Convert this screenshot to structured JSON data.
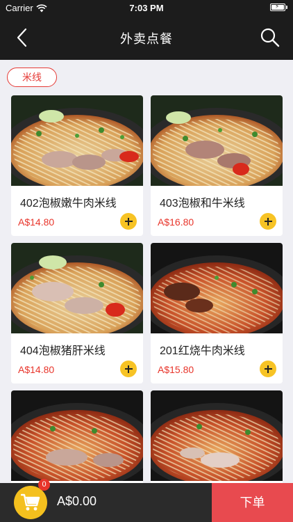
{
  "status_bar": {
    "carrier": "Carrier",
    "time": "7:03 PM"
  },
  "nav": {
    "title": "外卖点餐",
    "back_icon": "chevron-left-icon",
    "search_icon": "search-icon"
  },
  "category": {
    "label": "米线"
  },
  "products": [
    {
      "name": "402泡椒嫩牛肉米线",
      "price": "A$14.80"
    },
    {
      "name": "403泡椒和牛米线",
      "price": "A$16.80"
    },
    {
      "name": "404泡椒猪肝米线",
      "price": "A$14.80"
    },
    {
      "name": "201红烧牛肉米线",
      "price": "A$15.80"
    },
    {
      "name": "",
      "price": ""
    },
    {
      "name": "",
      "price": ""
    }
  ],
  "cart": {
    "count": "0",
    "total": "A$0.00",
    "icon": "shopping-cart-icon"
  },
  "checkout": {
    "label": "下单"
  },
  "colors": {
    "accent": "#e8352b",
    "add_button": "#f7c325",
    "checkout": "#e84a4f",
    "nav_bg": "#1c1c1c"
  }
}
